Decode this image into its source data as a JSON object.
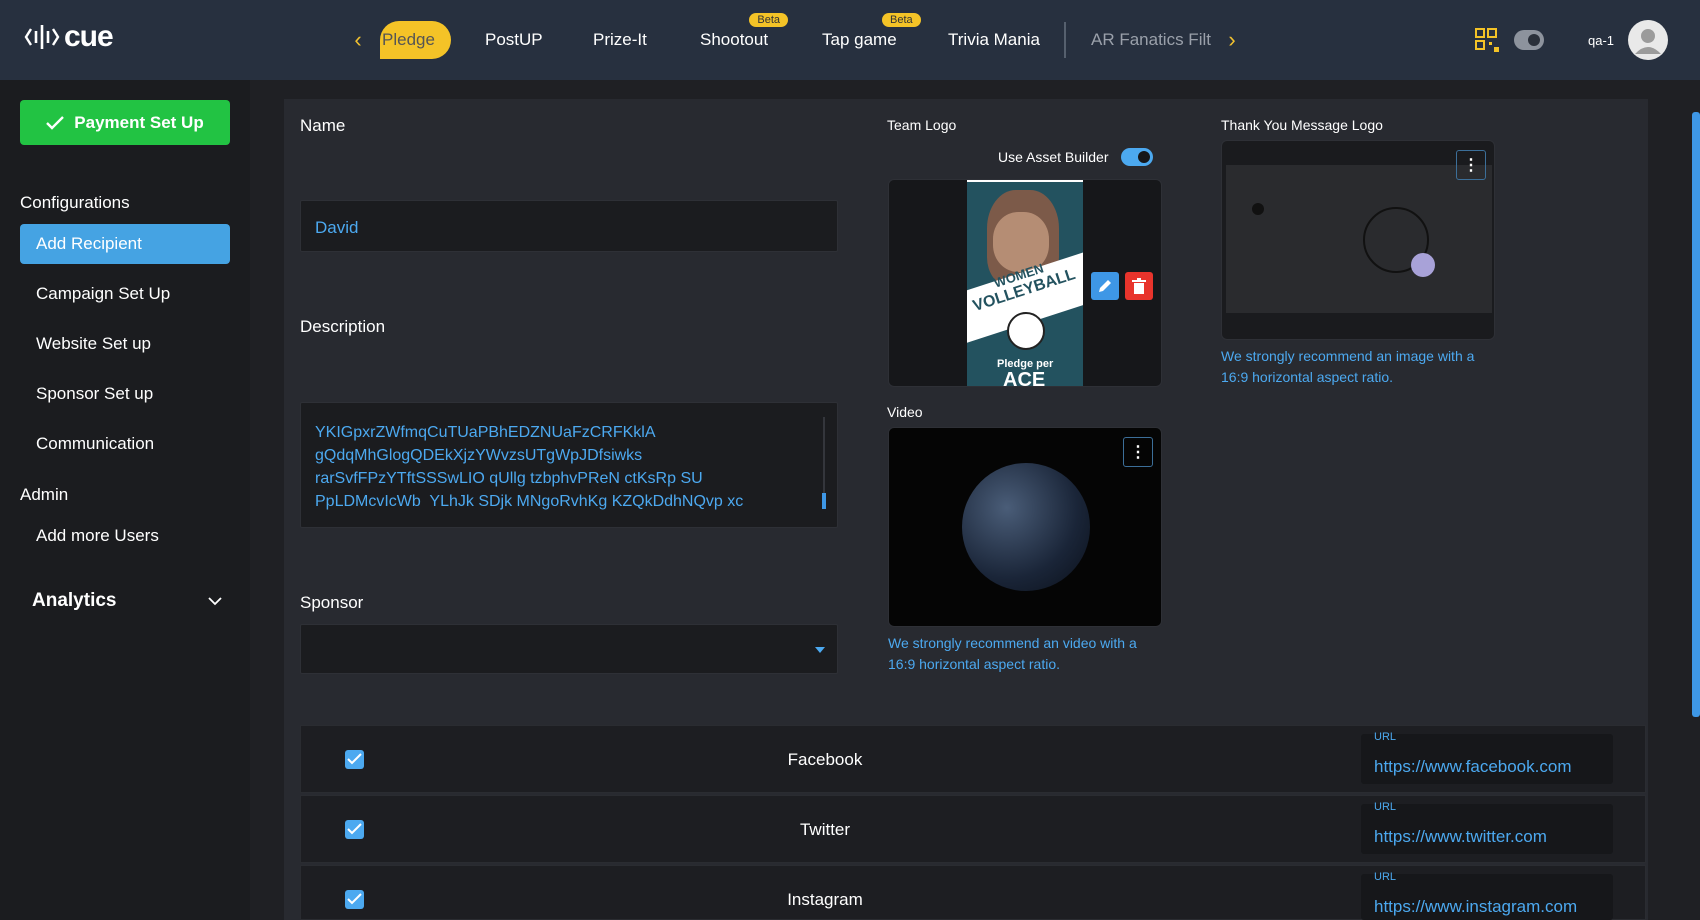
{
  "brand": {
    "name": "cue"
  },
  "nav": {
    "tabs": [
      {
        "label": "Pledge",
        "active": true
      },
      {
        "label": "PostUP"
      },
      {
        "label": "Prize-It"
      },
      {
        "label": "Shootout",
        "badge": "Beta"
      },
      {
        "label": "Tap game",
        "badge": "Beta"
      },
      {
        "label": "Trivia Mania"
      },
      {
        "label": "AR Fanatics Filt"
      }
    ]
  },
  "user": {
    "name": "qa-1"
  },
  "sidebar": {
    "payment_button": "Payment Set Up",
    "configurations_heading": "Configurations",
    "items": [
      "Add Recipient",
      "Campaign Set Up",
      "Website Set up",
      "Sponsor Set up",
      "Communication"
    ],
    "admin_heading": "Admin",
    "admin_items": [
      "Add more Users"
    ],
    "analytics": "Analytics"
  },
  "form": {
    "name_label": "Name",
    "name_value": "David",
    "description_label": "Description",
    "description_value": "YKIGpxrZWfmqCuTUaPBhEDZNUaFzCRFKklA\ngQdqMhGlogQDEkXjzYWvzsUTgWpJDfsiwks\nrarSvfFPzYTftSSSwLIO qUllg tzbphvPReN ctKsRp SU\nPpLDMcvIcWb  YLhJk SDjk MNgoRvhKg KZQkDdhNQvp xc",
    "sponsor_label": "Sponsor",
    "sponsor_value": ""
  },
  "team_logo": {
    "label": "Team Logo",
    "asset_builder_label": "Use Asset Builder",
    "asset_builder_on": true,
    "poster_text": [
      "WOMEN",
      "VOLLEYBALL",
      "Pledge per",
      "ACE"
    ]
  },
  "thank_you": {
    "label": "Thank You Message Logo",
    "hint": "We strongly recommend an image with a\n16:9 horizontal aspect ratio."
  },
  "video": {
    "label": "Video",
    "hint": "We strongly recommend an video with a\n16:9 horizontal aspect ratio."
  },
  "social": {
    "url_label": "URL",
    "rows": [
      {
        "name": "Facebook",
        "checked": true,
        "url": "https://www.facebook.com"
      },
      {
        "name": "Twitter",
        "checked": true,
        "url": "https://www.twitter.com"
      },
      {
        "name": "Instagram",
        "checked": true,
        "url": "https://www.instagram.com"
      }
    ]
  },
  "colors": {
    "accent": "#4ca9f0",
    "active_tab": "#f4c327",
    "payment_green": "#22c343",
    "topbar": "#27303f"
  }
}
